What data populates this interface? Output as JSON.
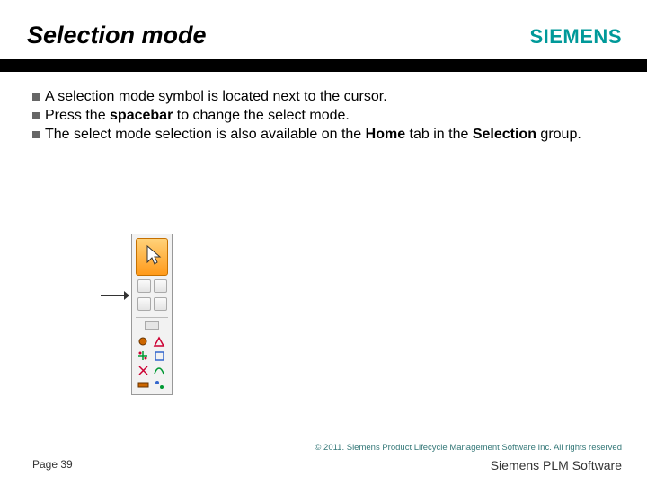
{
  "header": {
    "title": "Selection mode",
    "brand": "SIEMENS"
  },
  "bullets": [
    {
      "pre": "A selection mode symbol is located next to the cursor."
    },
    {
      "pre": "Press the ",
      "bold": "spacebar",
      "post": " to change the select mode."
    },
    {
      "pre": "The select mode selection is also available on the ",
      "bold": "Home",
      "mid": " tab in the ",
      "bold2": "Selection",
      "post": " group."
    }
  ],
  "icons": {
    "select_arrow": "select-arrow-icon"
  },
  "footer": {
    "copyright": "© 2011. Siemens Product Lifecycle Management Software Inc. All rights reserved",
    "page": "Page 39",
    "brandline": "Siemens PLM Software"
  }
}
